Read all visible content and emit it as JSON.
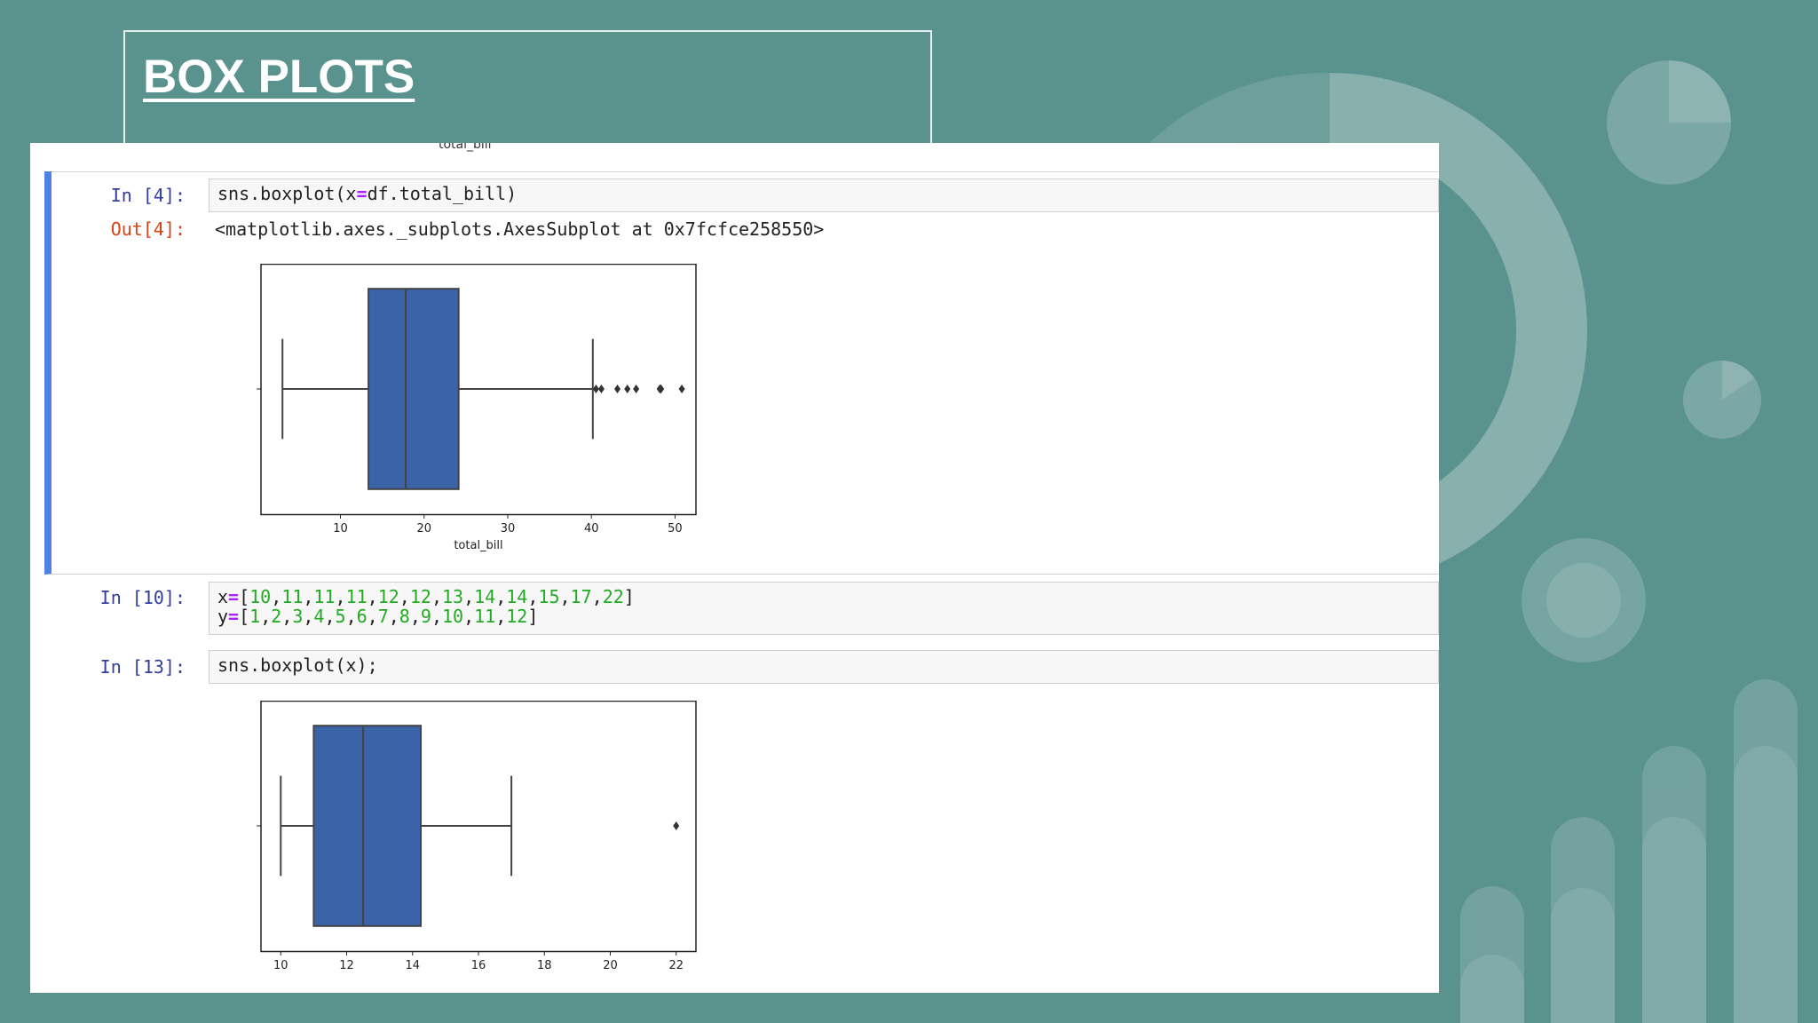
{
  "slide": {
    "title": "BOX PLOTS",
    "colors": {
      "background": "#5a928e",
      "box_fill": "#3b63a8",
      "selected_cell_bar": "#4f82e9"
    }
  },
  "notebook": {
    "previous_output_label": "total_bill",
    "cells": [
      {
        "prompt": "In [4]:",
        "code_parts": [
          "sns.boxplot(x",
          "=",
          "df.total_bill)"
        ],
        "output_prompt": "Out[4]:",
        "output_text": "<matplotlib.axes._subplots.AxesSubplot at 0x7fcfce258550>"
      },
      {
        "prompt": "In [10]:",
        "line1_parts": [
          "x",
          "=",
          "[",
          "10",
          ",",
          "11",
          ",",
          "11",
          ",",
          "11",
          ",",
          "12",
          ",",
          "12",
          ",",
          "13",
          ",",
          "14",
          ",",
          "14",
          ",",
          "15",
          ",",
          "17",
          ",",
          "22",
          "]"
        ],
        "line2_parts": [
          "y",
          "=",
          "[",
          "1",
          ",",
          "2",
          ",",
          "3",
          ",",
          "4",
          ",",
          "5",
          ",",
          "6",
          ",",
          "7",
          ",",
          "8",
          ",",
          "9",
          ",",
          "10",
          ",",
          "11",
          ",",
          "12",
          "]"
        ]
      },
      {
        "prompt": "In [13]:",
        "code": "sns.boxplot(x);"
      }
    ]
  },
  "chart_data": [
    {
      "type": "box",
      "orientation": "horizontal",
      "xlabel": "total_bill",
      "xlim": [
        0.5,
        52.5
      ],
      "xticks": [
        10,
        20,
        30,
        40,
        50
      ],
      "whisker_low": 3.07,
      "q1": 13.35,
      "median": 17.8,
      "q3": 24.13,
      "whisker_high": 40.17,
      "outliers": [
        40.55,
        41.19,
        43.11,
        44.3,
        45.35,
        48.17,
        48.27,
        48.33,
        50.81
      ],
      "box_color": "#3b63a8"
    },
    {
      "type": "box",
      "orientation": "horizontal",
      "xlabel": "",
      "xlim": [
        9.4,
        22.6
      ],
      "xticks": [
        10,
        12,
        14,
        16,
        18,
        20,
        22
      ],
      "whisker_low": 10,
      "q1": 11,
      "median": 12.5,
      "q3": 14.25,
      "whisker_high": 17,
      "outliers": [
        22
      ],
      "box_color": "#3b63a8"
    }
  ]
}
